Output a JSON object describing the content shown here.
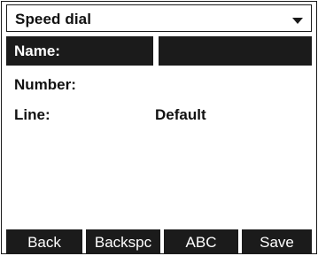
{
  "header": {
    "title": "Speed dial",
    "menu_icon": "chevron-down-icon"
  },
  "fields": {
    "name": {
      "label": "Name:",
      "value": ""
    },
    "number": {
      "label": "Number:",
      "value": ""
    },
    "line": {
      "label": "Line:",
      "value": "Default"
    }
  },
  "softkeys": [
    {
      "label": "Back"
    },
    {
      "label": "Backspc"
    },
    {
      "label": "ABC"
    },
    {
      "label": "Save"
    }
  ],
  "colors": {
    "highlight": "#1b1b1b",
    "background": "#ffffff",
    "text": "#111111"
  }
}
